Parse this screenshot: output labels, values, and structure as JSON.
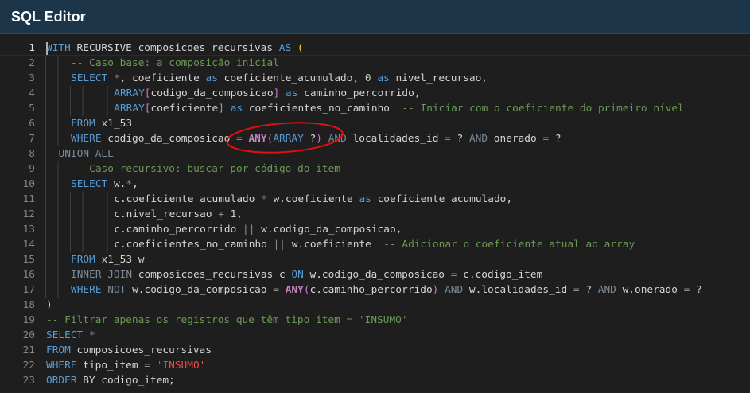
{
  "header": {
    "title": "SQL Editor"
  },
  "colors": {
    "header_bg": "#1c3549",
    "editor_bg": "#1e1e1e",
    "annotation": "#e01010"
  },
  "editor": {
    "active_line": 1,
    "lines": [
      {
        "n": "1",
        "indent": 0,
        "t": [
          [
            "kw",
            "WITH"
          ],
          [
            "pl",
            " RECURSIVE composicoes_recursivas "
          ],
          [
            "kw",
            "AS"
          ],
          [
            "pl",
            " "
          ],
          [
            "by",
            "("
          ]
        ]
      },
      {
        "n": "2",
        "indent": 4,
        "t": [
          [
            "cm",
            "-- Caso base: a composição inicial"
          ]
        ]
      },
      {
        "n": "3",
        "indent": 4,
        "t": [
          [
            "kw",
            "SELECT"
          ],
          [
            "pl",
            " "
          ],
          [
            "op",
            "*"
          ],
          [
            "pl",
            ", coeficiente "
          ],
          [
            "kw",
            "as"
          ],
          [
            "pl",
            " coeficiente_acumulado, "
          ],
          [
            "num",
            "0"
          ],
          [
            "pl",
            " "
          ],
          [
            "kw",
            "as"
          ],
          [
            "pl",
            " nivel_recursao,"
          ]
        ]
      },
      {
        "n": "4",
        "indent": 11,
        "t": [
          [
            "kw",
            "ARRAY"
          ],
          [
            "bp",
            "["
          ],
          [
            "pl",
            "codigo_da_composicao"
          ],
          [
            "bp",
            "]"
          ],
          [
            "pl",
            " "
          ],
          [
            "kw",
            "as"
          ],
          [
            "pl",
            " caminho_percorrido,"
          ]
        ]
      },
      {
        "n": "5",
        "indent": 11,
        "t": [
          [
            "kw",
            "ARRAY"
          ],
          [
            "bp",
            "["
          ],
          [
            "pl",
            "coeficiente"
          ],
          [
            "bp",
            "]"
          ],
          [
            "pl",
            " "
          ],
          [
            "kw",
            "as"
          ],
          [
            "pl",
            " coeficientes_no_caminho  "
          ],
          [
            "cm",
            "-- Iniciar com o coeficiente do primeiro nível"
          ]
        ]
      },
      {
        "n": "6",
        "indent": 4,
        "t": [
          [
            "kw",
            "FROM"
          ],
          [
            "pl",
            " x1_53"
          ]
        ]
      },
      {
        "n": "7",
        "indent": 4,
        "t": [
          [
            "kw",
            "WHERE"
          ],
          [
            "pl",
            " codigo_da_composicao "
          ],
          [
            "op",
            "="
          ],
          [
            "pl",
            " "
          ],
          [
            "fn",
            "ANY"
          ],
          [
            "bp",
            "("
          ],
          [
            "kw",
            "ARRAY"
          ],
          [
            "pl",
            " ?"
          ],
          [
            "bp",
            ")"
          ],
          [
            "pl",
            " "
          ],
          [
            "kwd",
            "AND"
          ],
          [
            "pl",
            " localidades_id "
          ],
          [
            "op",
            "="
          ],
          [
            "pl",
            " ? "
          ],
          [
            "kwd",
            "AND"
          ],
          [
            "pl",
            " onerado "
          ],
          [
            "op",
            "="
          ],
          [
            "pl",
            " ?"
          ]
        ]
      },
      {
        "n": "8",
        "indent": 2,
        "t": [
          [
            "kwd",
            "UNION ALL"
          ]
        ]
      },
      {
        "n": "9",
        "indent": 4,
        "t": [
          [
            "cm",
            "-- Caso recursivo: buscar por código do item"
          ]
        ]
      },
      {
        "n": "10",
        "indent": 4,
        "t": [
          [
            "kw",
            "SELECT"
          ],
          [
            "pl",
            " w."
          ],
          [
            "op",
            "*"
          ],
          [
            "pl",
            ","
          ]
        ]
      },
      {
        "n": "11",
        "indent": 11,
        "t": [
          [
            "pl",
            "c.coeficiente_acumulado "
          ],
          [
            "op",
            "*"
          ],
          [
            "pl",
            " w.coeficiente "
          ],
          [
            "kw",
            "as"
          ],
          [
            "pl",
            " coeficiente_acumulado,"
          ]
        ]
      },
      {
        "n": "12",
        "indent": 11,
        "t": [
          [
            "pl",
            "c.nivel_recursao "
          ],
          [
            "op",
            "+"
          ],
          [
            "pl",
            " 1,"
          ]
        ]
      },
      {
        "n": "13",
        "indent": 11,
        "t": [
          [
            "pl",
            "c.caminho_percorrido "
          ],
          [
            "op",
            "||"
          ],
          [
            "pl",
            " w.codigo_da_composicao,"
          ]
        ]
      },
      {
        "n": "14",
        "indent": 11,
        "t": [
          [
            "pl",
            "c.coeficientes_no_caminho "
          ],
          [
            "op",
            "||"
          ],
          [
            "pl",
            " w.coeficiente  "
          ],
          [
            "cm",
            "-- Adicionar o coeficiente atual ao array"
          ]
        ]
      },
      {
        "n": "15",
        "indent": 4,
        "t": [
          [
            "kw",
            "FROM"
          ],
          [
            "pl",
            " x1_53 w"
          ]
        ]
      },
      {
        "n": "16",
        "indent": 4,
        "t": [
          [
            "kwd",
            "INNER JOIN"
          ],
          [
            "pl",
            " composicoes_recursivas c "
          ],
          [
            "kw",
            "ON"
          ],
          [
            "pl",
            " w.codigo_da_composicao "
          ],
          [
            "op",
            "="
          ],
          [
            "pl",
            " c.codigo_item"
          ]
        ]
      },
      {
        "n": "17",
        "indent": 4,
        "t": [
          [
            "kw",
            "WHERE"
          ],
          [
            "pl",
            " "
          ],
          [
            "kwd",
            "NOT"
          ],
          [
            "pl",
            " w.codigo_da_composicao "
          ],
          [
            "op",
            "="
          ],
          [
            "pl",
            " "
          ],
          [
            "fn",
            "ANY"
          ],
          [
            "bp",
            "("
          ],
          [
            "pl",
            "c.caminho_percorrido"
          ],
          [
            "bp",
            ")"
          ],
          [
            "pl",
            " "
          ],
          [
            "kwd",
            "AND"
          ],
          [
            "pl",
            " w.localidades_id "
          ],
          [
            "op",
            "="
          ],
          [
            "pl",
            " ? "
          ],
          [
            "kwd",
            "AND"
          ],
          [
            "pl",
            " w.onerado "
          ],
          [
            "op",
            "="
          ],
          [
            "pl",
            " ?"
          ]
        ]
      },
      {
        "n": "18",
        "indent": 0,
        "t": [
          [
            "by",
            ")"
          ]
        ]
      },
      {
        "n": "19",
        "indent": 0,
        "t": [
          [
            "cm",
            "-- Filtrar apenas os registros que têm tipo_item = 'INSUMO'"
          ]
        ]
      },
      {
        "n": "20",
        "indent": 0,
        "t": [
          [
            "kw",
            "SELECT"
          ],
          [
            "pl",
            " "
          ],
          [
            "op",
            "*"
          ]
        ]
      },
      {
        "n": "21",
        "indent": 0,
        "t": [
          [
            "kw",
            "FROM"
          ],
          [
            "pl",
            " composicoes_recursivas"
          ]
        ]
      },
      {
        "n": "22",
        "indent": 0,
        "t": [
          [
            "kw",
            "WHERE"
          ],
          [
            "pl",
            " tipo_item "
          ],
          [
            "op",
            "="
          ],
          [
            "pl",
            " "
          ],
          [
            "str",
            "'INSUMO'"
          ]
        ]
      },
      {
        "n": "23",
        "indent": 0,
        "t": [
          [
            "kw",
            "ORDER"
          ],
          [
            "pl",
            " BY codigo_item;"
          ]
        ]
      }
    ]
  }
}
